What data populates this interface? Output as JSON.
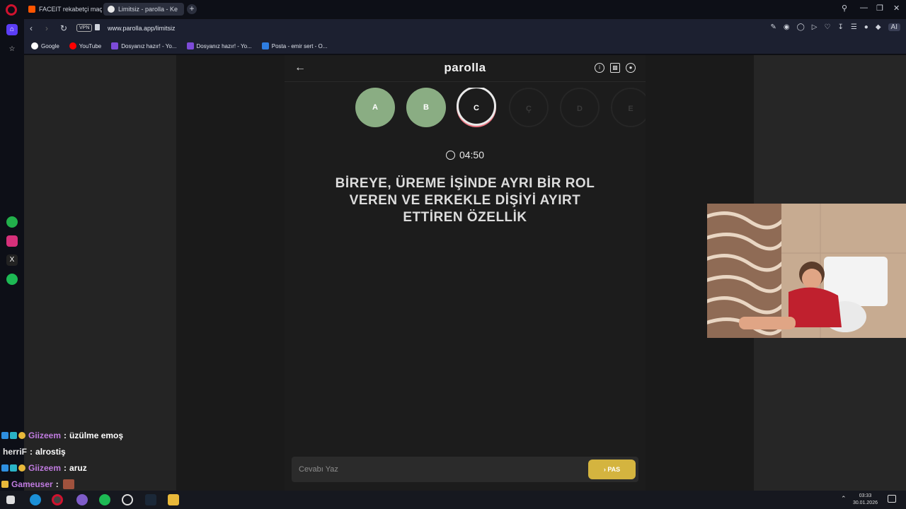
{
  "browser": {
    "tabs": [
      {
        "label": "FACEIT rekabetçi maç - FA"
      },
      {
        "label": "Limitsiz - parolla - Ke"
      }
    ],
    "new_tab": "+",
    "address": {
      "vpn": "VPN",
      "url": "www.parolla.app/limitsiz"
    },
    "ai_label": "AI",
    "bookmarks": [
      {
        "label": "Google"
      },
      {
        "label": "YouTube"
      },
      {
        "label": "Dosyanız hazır! - Yo..."
      },
      {
        "label": "Dosyanız hazır! - Yo..."
      },
      {
        "label": "Posta - emir sert - O..."
      }
    ]
  },
  "app": {
    "logo": "parolla",
    "letters": [
      {
        "label": "A",
        "state": "done"
      },
      {
        "label": "B",
        "state": "done"
      },
      {
        "label": "C",
        "state": "current"
      },
      {
        "label": "Ç",
        "state": "todo"
      },
      {
        "label": "D",
        "state": "todo"
      },
      {
        "label": "E",
        "state": "todo"
      }
    ],
    "timer": "04:50",
    "question_lines": [
      "BİREYE, ÜREME İŞİNDE AYRI BİR ROL",
      "VEREN VE ERKEKLE DİŞİYİ AYIRT",
      "ETTİREN ÖZELLİK"
    ],
    "answer_placeholder": "Cevabı Yaz",
    "pass_label": "› PAS"
  },
  "chat": [
    {
      "user": "Giizeem",
      "sep": ":",
      "msg": "üzülme emoş",
      "color": "#c07be0"
    },
    {
      "user": "herriF",
      "sep": ":",
      "msg": "alrostiş",
      "color": "#e8e8e8"
    },
    {
      "user": "Giizeem",
      "sep": ":",
      "msg": "aruz",
      "color": "#c07be0"
    },
    {
      "user": "Gameuser",
      "sep": ":",
      "msg": "",
      "color": "#c07be0"
    }
  ],
  "taskbar": {
    "time": "03:33",
    "date": "30.01.2026"
  },
  "colors": {
    "letter_done": "#8aad83",
    "pass_button": "#d4b43f",
    "accent_red": "#d0122e"
  }
}
